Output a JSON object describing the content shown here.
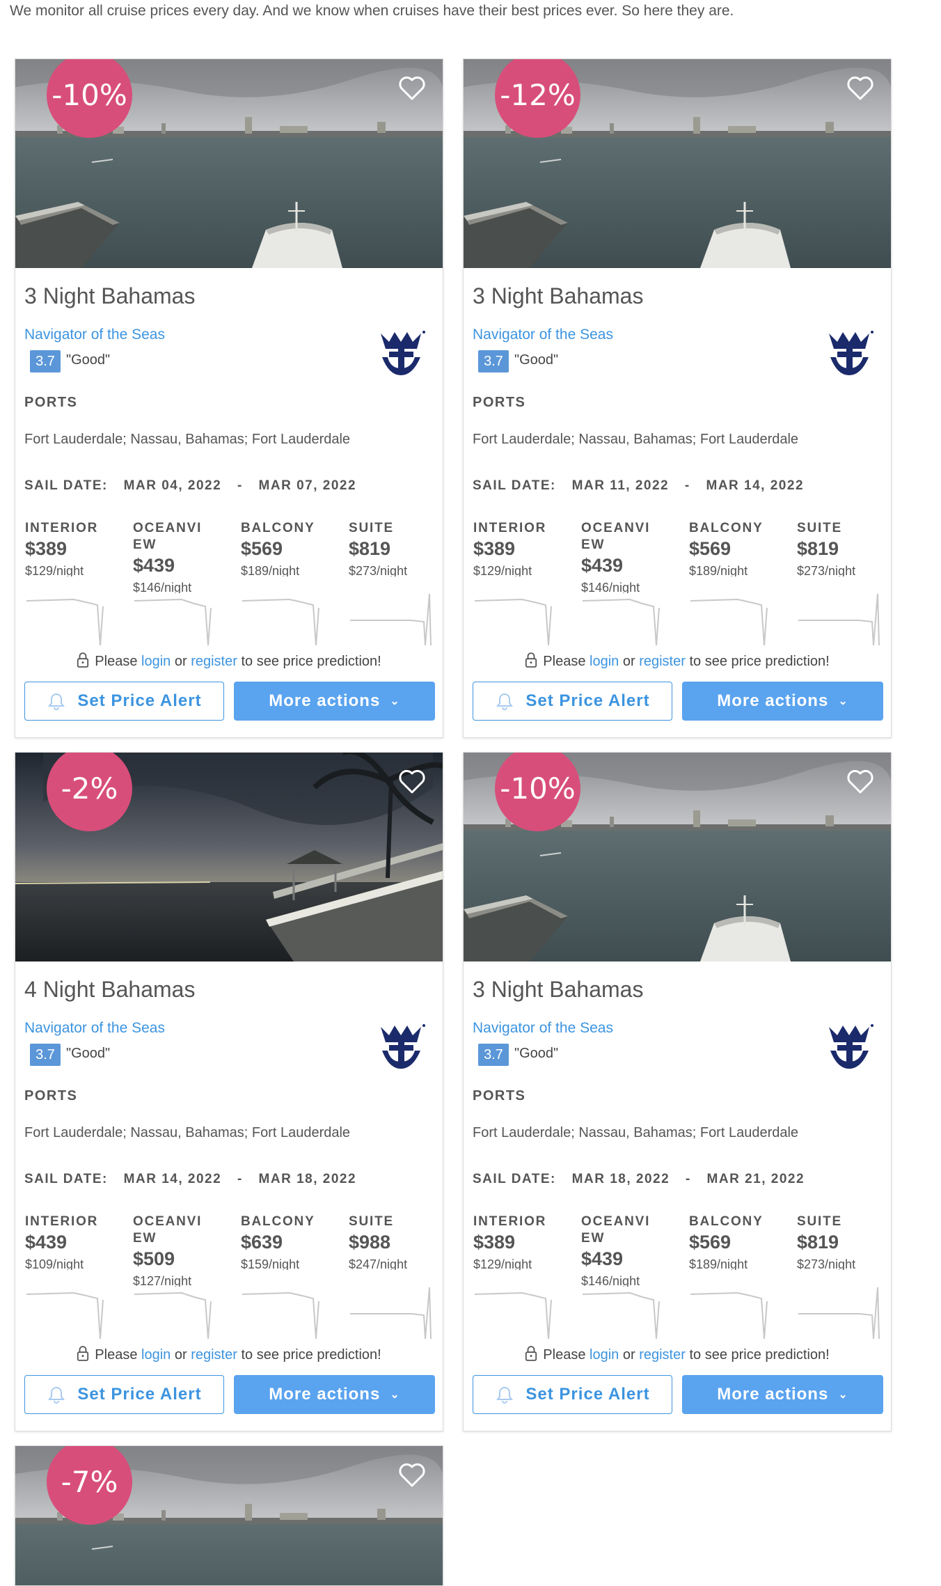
{
  "intro": "We monitor all cruise prices every day. And we know when cruises have their best prices ever. So here they are.",
  "labels": {
    "ports": "PORTS",
    "sail_date": "SAIL DATE:",
    "date_sep": "-",
    "interior": "INTERIOR",
    "oceanview": "OCEANVIEW",
    "balcony": "BALCONY",
    "suite": "SUITE",
    "please": "Please",
    "login": "login",
    "or": "or",
    "register": "register",
    "prediction": "to see price prediction!",
    "set_alert": "Set Price Alert",
    "more_actions": "More actions"
  },
  "colors": {
    "discount_badge": "#d84e7a",
    "link": "#3c94e0",
    "primary_button": "#5aa3ef",
    "rating": "#5b97d8",
    "logo": "#1b2a6b"
  },
  "icons": [
    "heart-icon",
    "lock-icon",
    "bell-icon",
    "chevron-down-icon",
    "royal-caribbean-logo"
  ],
  "cards": [
    {
      "discount": "-10%",
      "photo": "port",
      "title": "3 Night Bahamas",
      "ship": "Navigator of the Seas",
      "rating": "3.7",
      "rating_text": "\"Good\"",
      "ports": "Fort Lauderdale; Nassau, Bahamas; Fort Lauderdale",
      "sail_from": "MAR 04, 2022",
      "sail_to": "MAR 07, 2022",
      "prices": [
        {
          "price": "$389",
          "per_night": "$129/night"
        },
        {
          "price": "$439",
          "per_night": "$146/night"
        },
        {
          "price": "$569",
          "per_night": "$189/night"
        },
        {
          "price": "$819",
          "per_night": "$273/night"
        }
      ]
    },
    {
      "discount": "-12%",
      "photo": "port",
      "title": "3 Night Bahamas",
      "ship": "Navigator of the Seas",
      "rating": "3.7",
      "rating_text": "\"Good\"",
      "ports": "Fort Lauderdale; Nassau, Bahamas; Fort Lauderdale",
      "sail_from": "MAR 11, 2022",
      "sail_to": "MAR 14, 2022",
      "prices": [
        {
          "price": "$389",
          "per_night": "$129/night"
        },
        {
          "price": "$439",
          "per_night": "$146/night"
        },
        {
          "price": "$569",
          "per_night": "$189/night"
        },
        {
          "price": "$819",
          "per_night": "$273/night"
        }
      ]
    },
    {
      "discount": "-2%",
      "photo": "night",
      "title": "4 Night Bahamas",
      "ship": "Navigator of the Seas",
      "rating": "3.7",
      "rating_text": "\"Good\"",
      "ports": "Fort Lauderdale; Nassau, Bahamas; Fort Lauderdale",
      "sail_from": "MAR 14, 2022",
      "sail_to": "MAR 18, 2022",
      "prices": [
        {
          "price": "$439",
          "per_night": "$109/night"
        },
        {
          "price": "$509",
          "per_night": "$127/night"
        },
        {
          "price": "$639",
          "per_night": "$159/night"
        },
        {
          "price": "$988",
          "per_night": "$247/night"
        }
      ]
    },
    {
      "discount": "-10%",
      "photo": "port",
      "title": "3 Night Bahamas",
      "ship": "Navigator of the Seas",
      "rating": "3.7",
      "rating_text": "\"Good\"",
      "ports": "Fort Lauderdale; Nassau, Bahamas; Fort Lauderdale",
      "sail_from": "MAR 18, 2022",
      "sail_to": "MAR 21, 2022",
      "prices": [
        {
          "price": "$389",
          "per_night": "$129/night"
        },
        {
          "price": "$439",
          "per_night": "$146/night"
        },
        {
          "price": "$569",
          "per_night": "$189/night"
        },
        {
          "price": "$819",
          "per_night": "$273/night"
        }
      ]
    },
    {
      "discount": "-7%",
      "photo": "port"
    }
  ]
}
